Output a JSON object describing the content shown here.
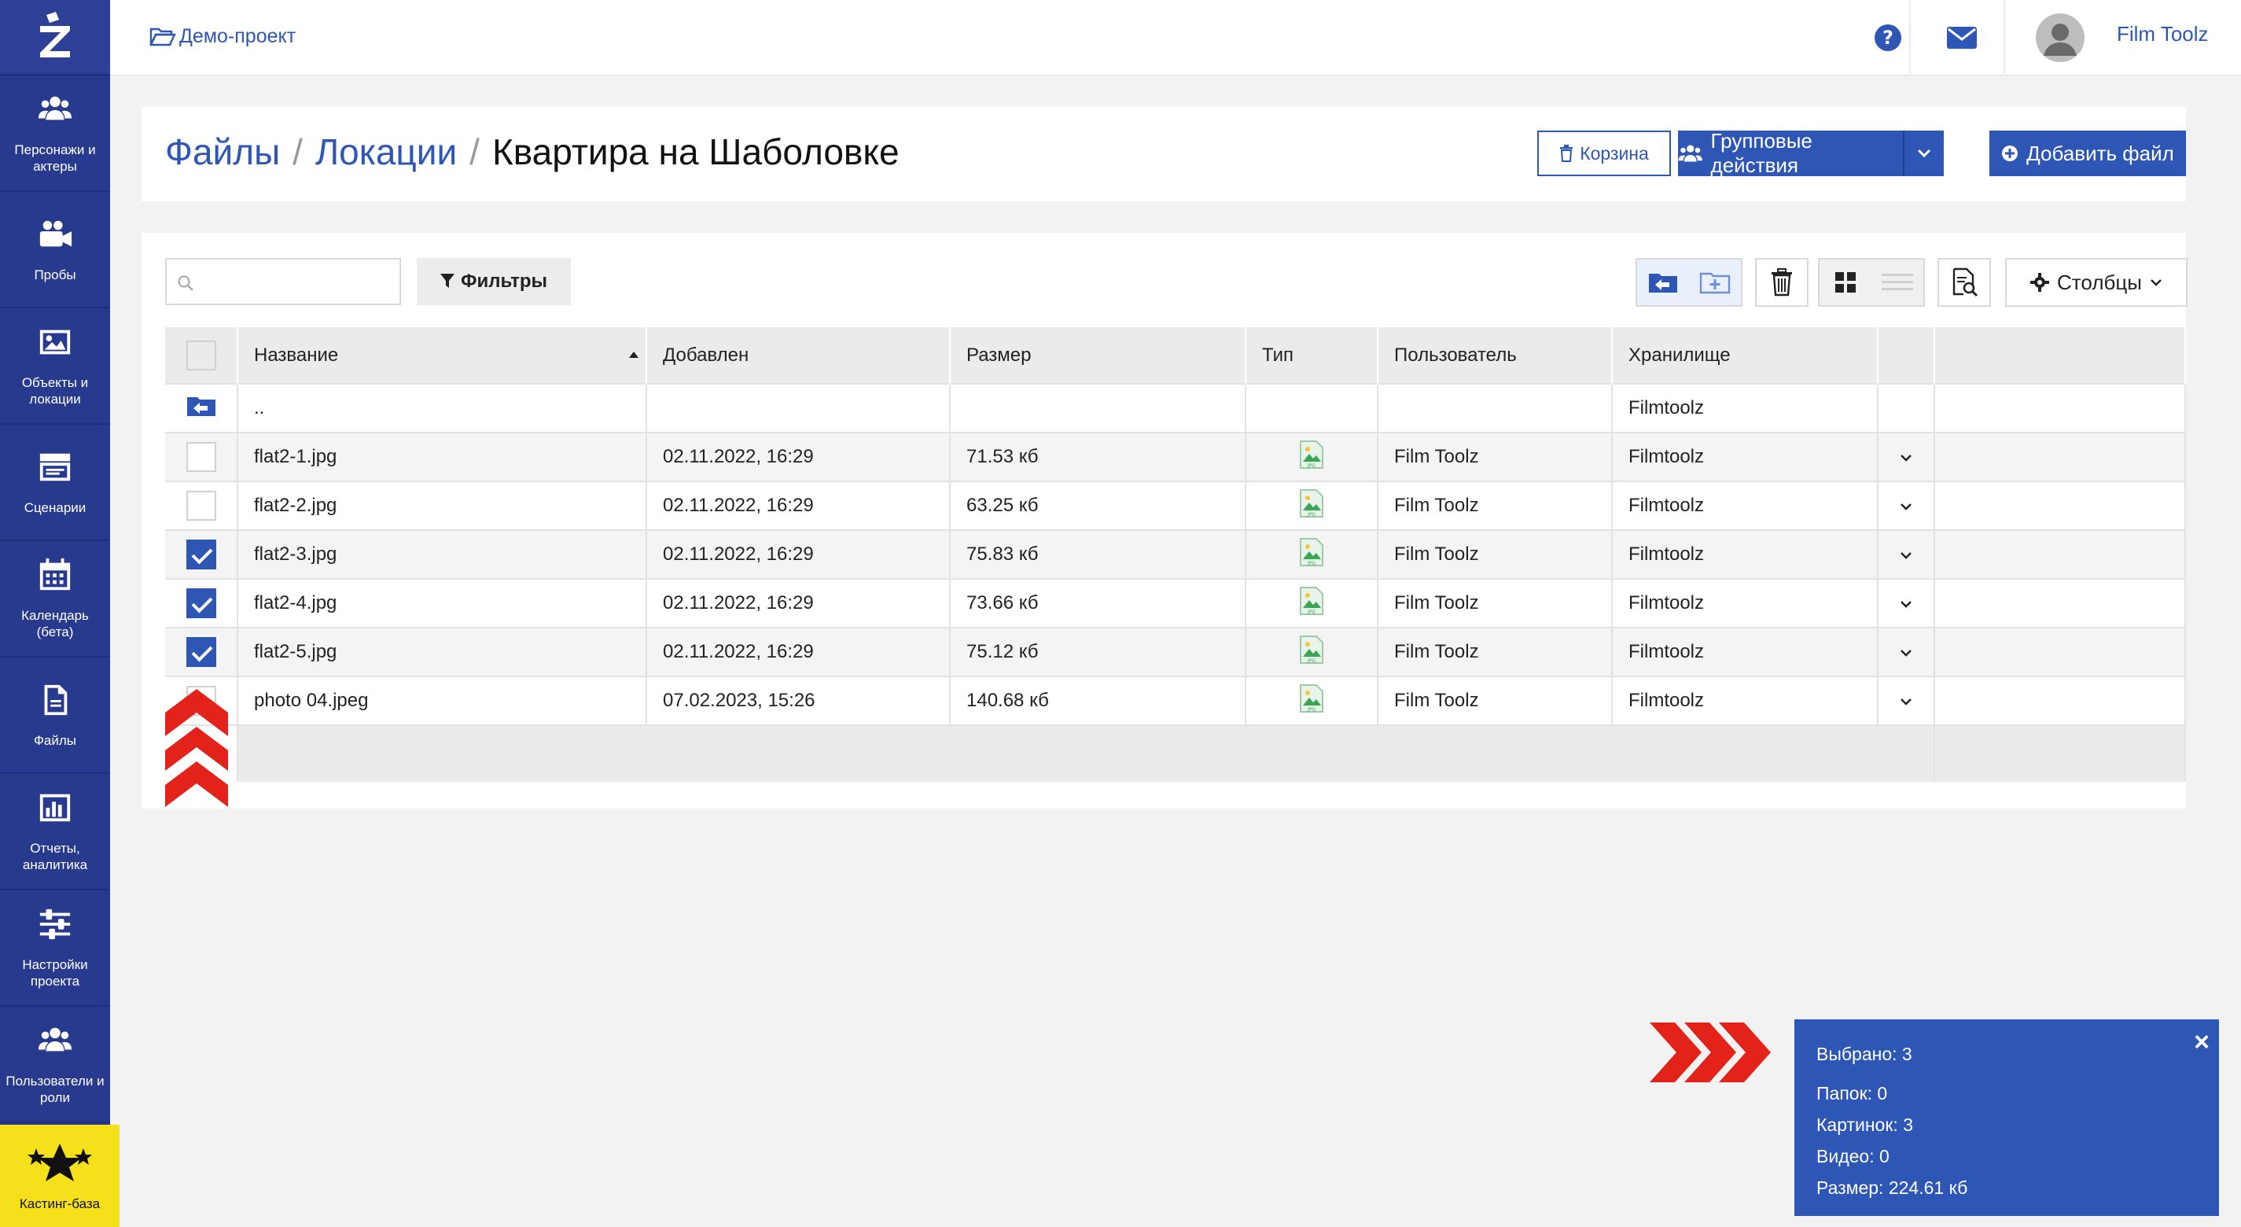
{
  "sidebar": {
    "items": [
      {
        "label": "Персонажи и\nактеры",
        "icon": "users-icon"
      },
      {
        "label": "Пробы",
        "icon": "video-camera-icon"
      },
      {
        "label": "Объекты и\nлокации",
        "icon": "image-icon"
      },
      {
        "label": "Сценарии",
        "icon": "clapperboard-icon"
      },
      {
        "label": "Календарь\n(бета)",
        "icon": "calendar-icon"
      },
      {
        "label": "Файлы",
        "icon": "file-icon"
      },
      {
        "label": "Отчеты,\nаналитика",
        "icon": "bar-chart-icon"
      },
      {
        "label": "Настройки\nпроекта",
        "icon": "sliders-icon"
      },
      {
        "label": "Пользователи и\nроли",
        "icon": "users-roles-icon"
      }
    ],
    "casting": {
      "label": "Кастинг-база",
      "icon": "stars-icon"
    }
  },
  "topbar": {
    "project": "Демо-проект",
    "username": "Film Toolz"
  },
  "breadcrumb": {
    "items": [
      "Файлы",
      "Локации"
    ],
    "current": "Квартира на Шаболовке"
  },
  "actions": {
    "trash": "Корзина",
    "group": "Групповые действия",
    "add_file": "Добавить файл"
  },
  "toolbar": {
    "search_placeholder": "",
    "filters": "Фильтры",
    "columns": "Столбцы"
  },
  "table": {
    "headers": {
      "name": "Название",
      "added": "Добавлен",
      "size": "Размер",
      "type": "Тип",
      "user": "Пользователь",
      "storage": "Хранилище"
    },
    "parent_row": {
      "name": "..",
      "storage": "Filmtoolz"
    },
    "rows": [
      {
        "name": "flat2-1.jpg",
        "added": "02.11.2022, 16:29",
        "size": "71.53 кб",
        "user": "Film Toolz",
        "storage": "Filmtoolz",
        "checked": false
      },
      {
        "name": "flat2-2.jpg",
        "added": "02.11.2022, 16:29",
        "size": "63.25 кб",
        "user": "Film Toolz",
        "storage": "Filmtoolz",
        "checked": false
      },
      {
        "name": "flat2-3.jpg",
        "added": "02.11.2022, 16:29",
        "size": "75.83 кб",
        "user": "Film Toolz",
        "storage": "Filmtoolz",
        "checked": true
      },
      {
        "name": "flat2-4.jpg",
        "added": "02.11.2022, 16:29",
        "size": "73.66 кб",
        "user": "Film Toolz",
        "storage": "Filmtoolz",
        "checked": true
      },
      {
        "name": "flat2-5.jpg",
        "added": "02.11.2022, 16:29",
        "size": "75.12 кб",
        "user": "Film Toolz",
        "storage": "Filmtoolz",
        "checked": true
      },
      {
        "name": "photo 04.jpeg",
        "added": "07.02.2023, 15:26",
        "size": "140.68 кб",
        "user": "Film Toolz",
        "storage": "Filmtoolz",
        "checked": false
      }
    ]
  },
  "selection": {
    "selected": "Выбрано: 3",
    "folders": "Папок: 0",
    "images": "Картинок: 3",
    "videos": "Видео: 0",
    "size": "Размер: 224.61 кб",
    "close": "×"
  },
  "colors": {
    "accent": "#2e56b4",
    "sidebar": "#283a8e",
    "casting": "#f5e01b",
    "annotation": "#e32219"
  }
}
